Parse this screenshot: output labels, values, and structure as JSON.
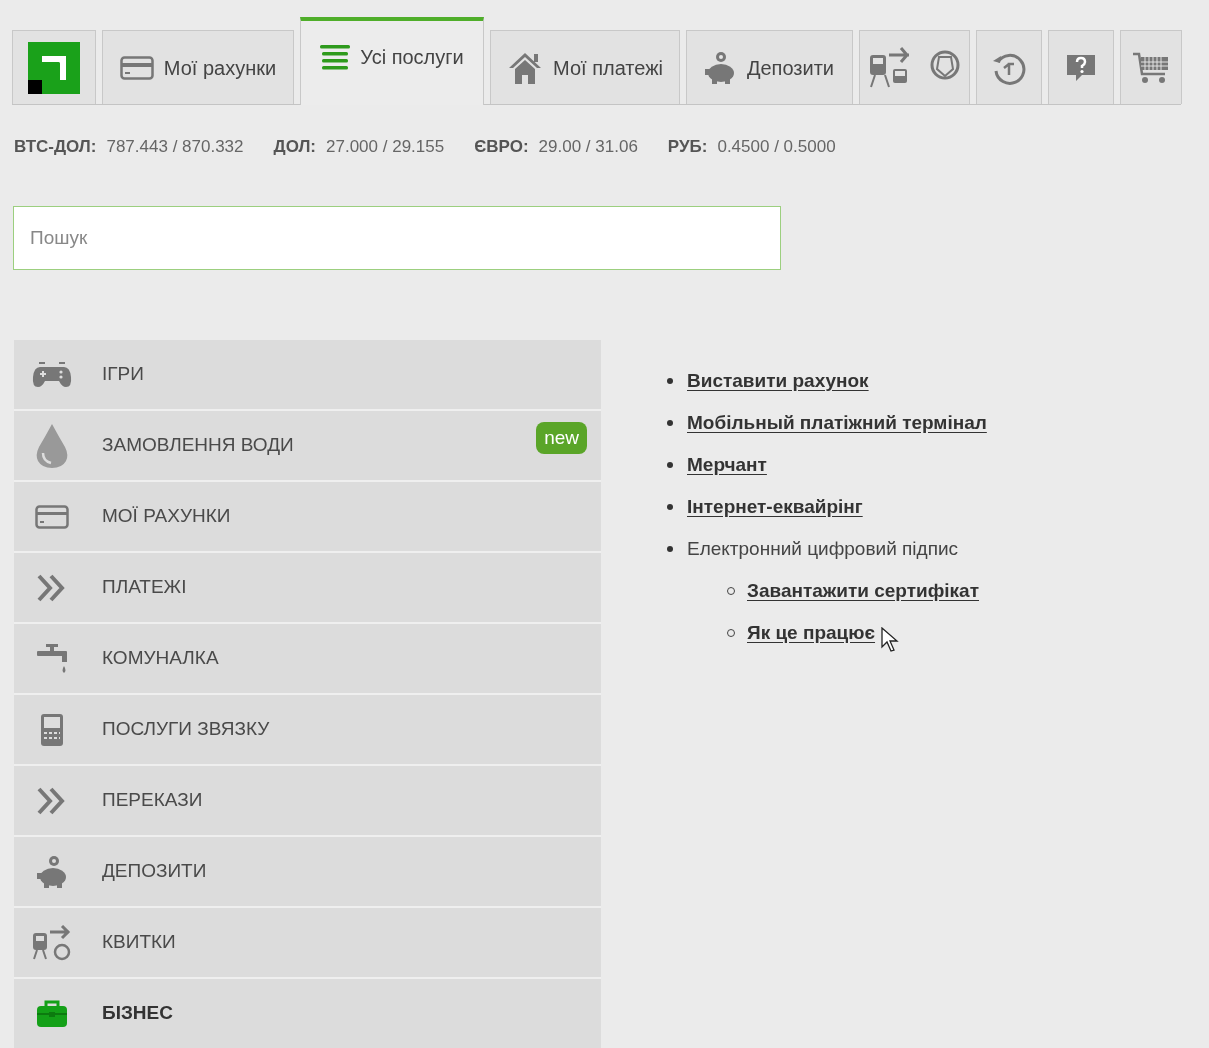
{
  "nav_tabs": [
    {
      "kind": "logo",
      "selected": false
    },
    {
      "label": "Мої рахунки",
      "kind": "text",
      "selected": false
    },
    {
      "label": "Усі послуги",
      "kind": "text",
      "selected": true
    },
    {
      "label": "Мої платежі",
      "kind": "text",
      "selected": false
    },
    {
      "label": "Депозити",
      "kind": "text",
      "selected": false
    },
    {
      "kind": "icon",
      "selected": false
    },
    {
      "kind": "icon",
      "selected": false
    },
    {
      "kind": "icon",
      "selected": false
    },
    {
      "kind": "icon",
      "selected": false
    }
  ],
  "rates": [
    {
      "label": "ВТС-ДОЛ:",
      "value": "787.443 / 870.332"
    },
    {
      "label": "ДОЛ:",
      "value": "27.000 / 29.155"
    },
    {
      "label": "ЄВРО:",
      "value": "29.00 / 31.06"
    },
    {
      "label": "РУБ:",
      "value": "0.4500 / 0.5000"
    }
  ],
  "search": {
    "placeholder": "Пошук"
  },
  "categories": [
    {
      "label": "ІГРИ",
      "selected": false
    },
    {
      "label": "ЗАМОВЛЕННЯ ВОДИ",
      "badge": "new",
      "selected": false
    },
    {
      "label": "МОЇ РАХУНКИ",
      "selected": false
    },
    {
      "label": "ПЛАТЕЖІ",
      "selected": false
    },
    {
      "label": "КОМУНАЛКА",
      "selected": false
    },
    {
      "label": "ПОСЛУГИ ЗВЯЗКУ",
      "selected": false
    },
    {
      "label": "ПЕРЕКАЗИ",
      "selected": false
    },
    {
      "label": "ДЕПОЗИТИ",
      "selected": false
    },
    {
      "label": "КВИТКИ",
      "selected": false
    },
    {
      "label": "БІЗНЕС",
      "selected": true
    }
  ],
  "services": [
    {
      "label": "Виставити рахунок",
      "kind": "link"
    },
    {
      "label": "Мобільный платіжний термінал",
      "kind": "link"
    },
    {
      "label": "Мерчант",
      "kind": "link"
    },
    {
      "label": "Інтернет-еквайрінг",
      "kind": "link"
    },
    {
      "label": "Електронний цифровий підпис",
      "kind": "text",
      "children": [
        {
          "label": "Завантажити сертифікат",
          "kind": "link"
        },
        {
          "label": "Як це працює",
          "kind": "link"
        }
      ]
    }
  ]
}
